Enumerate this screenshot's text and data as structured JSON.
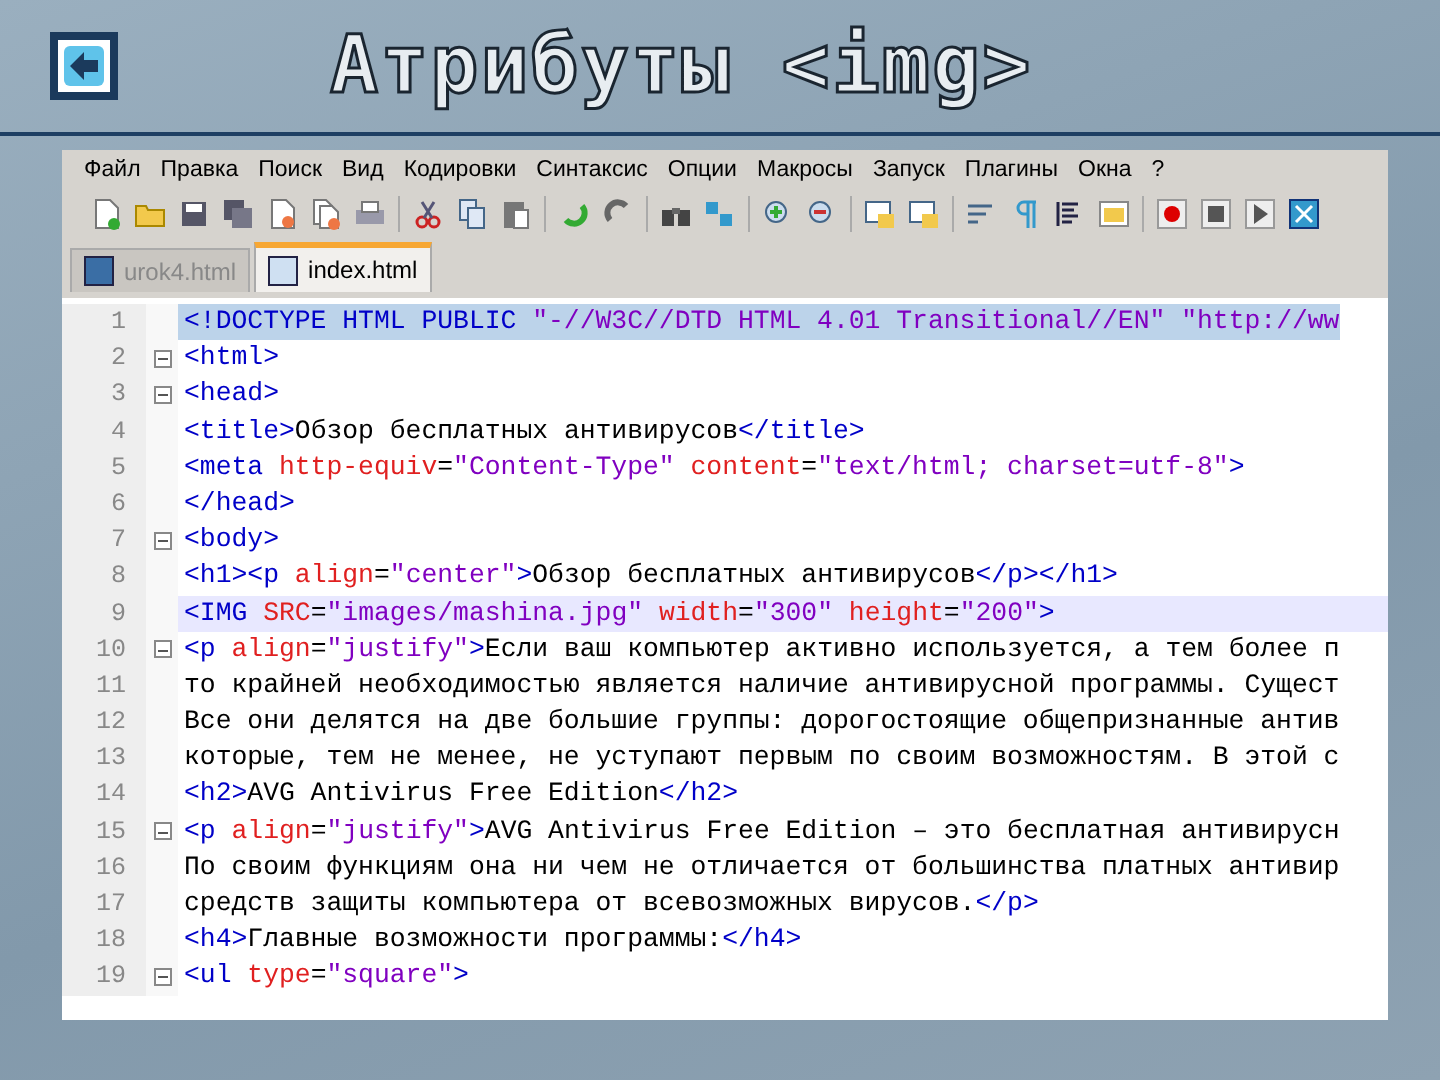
{
  "slide": {
    "title": "Атрибуты <img>"
  },
  "menu": [
    "Файл",
    "Правка",
    "Поиск",
    "Вид",
    "Кодировки",
    "Синтаксис",
    "Опции",
    "Макросы",
    "Запуск",
    "Плагины",
    "Окна",
    "?"
  ],
  "tabs": [
    {
      "label": "urok4.html",
      "selected": false
    },
    {
      "label": "index.html",
      "selected": true
    }
  ],
  "lines": [
    {
      "number": "1",
      "fold": false,
      "current": false,
      "marked": true,
      "segments": [
        {
          "kind": "tag",
          "text": "<!DOCTYPE HTML PUBLIC "
        },
        {
          "kind": "value",
          "text": "\"-//W3C//DTD HTML 4.01 Transitional//EN\""
        },
        {
          "kind": "value",
          "text": " \"http://ww"
        }
      ]
    },
    {
      "number": "2",
      "fold": true,
      "current": false,
      "marked": false,
      "segments": [
        {
          "kind": "tag",
          "text": "<html>"
        }
      ]
    },
    {
      "number": "3",
      "fold": true,
      "current": false,
      "marked": false,
      "segments": [
        {
          "kind": "tag",
          "text": "<head>"
        }
      ]
    },
    {
      "number": "4",
      "fold": false,
      "current": false,
      "marked": false,
      "segments": [
        {
          "kind": "tag",
          "text": "<title>"
        },
        {
          "kind": "text",
          "text": "Обзор бесплатных антивирусов"
        },
        {
          "kind": "tag",
          "text": "</title>"
        }
      ]
    },
    {
      "number": "5",
      "fold": false,
      "current": false,
      "marked": false,
      "segments": [
        {
          "kind": "tag",
          "text": "<meta "
        },
        {
          "kind": "attr",
          "text": "http-equiv"
        },
        {
          "kind": "text",
          "text": "="
        },
        {
          "kind": "value",
          "text": "\"Content-Type\""
        },
        {
          "kind": "attr",
          "text": " content"
        },
        {
          "kind": "text",
          "text": "="
        },
        {
          "kind": "value",
          "text": "\"text/html; charset=utf-8\""
        },
        {
          "kind": "tag",
          "text": ">"
        }
      ]
    },
    {
      "number": "6",
      "fold": false,
      "current": false,
      "marked": false,
      "segments": [
        {
          "kind": "tag",
          "text": "</head>"
        }
      ]
    },
    {
      "number": "7",
      "fold": true,
      "current": false,
      "marked": false,
      "segments": [
        {
          "kind": "tag",
          "text": "<body>"
        }
      ]
    },
    {
      "number": "8",
      "fold": false,
      "current": false,
      "marked": false,
      "segments": [
        {
          "kind": "tag",
          "text": "<h1><p "
        },
        {
          "kind": "attr",
          "text": "align"
        },
        {
          "kind": "text",
          "text": "="
        },
        {
          "kind": "value",
          "text": "\"center\""
        },
        {
          "kind": "tag",
          "text": ">"
        },
        {
          "kind": "text",
          "text": "Обзор бесплатных антивирусов"
        },
        {
          "kind": "tag",
          "text": "</p></h1>"
        }
      ]
    },
    {
      "number": "9",
      "fold": false,
      "current": true,
      "marked": false,
      "segments": [
        {
          "kind": "tag",
          "text": "<IMG "
        },
        {
          "kind": "attr",
          "text": "SRC"
        },
        {
          "kind": "text",
          "text": "="
        },
        {
          "kind": "value",
          "text": "\"images/mashina.jpg\""
        },
        {
          "kind": "attr",
          "text": " width"
        },
        {
          "kind": "text",
          "text": "="
        },
        {
          "kind": "value",
          "text": "\"300\""
        },
        {
          "kind": "attr",
          "text": " height"
        },
        {
          "kind": "text",
          "text": "="
        },
        {
          "kind": "value",
          "text": "\"200\""
        },
        {
          "kind": "tag",
          "text": ">"
        }
      ]
    },
    {
      "number": "10",
      "fold": true,
      "current": false,
      "marked": false,
      "segments": [
        {
          "kind": "tag",
          "text": "<p "
        },
        {
          "kind": "attr",
          "text": "align"
        },
        {
          "kind": "text",
          "text": "="
        },
        {
          "kind": "value",
          "text": "\"justify\""
        },
        {
          "kind": "tag",
          "text": ">"
        },
        {
          "kind": "text",
          "text": "Если ваш компьютер активно используется, а тем более п"
        }
      ]
    },
    {
      "number": "11",
      "fold": false,
      "current": false,
      "marked": false,
      "segments": [
        {
          "kind": "text",
          "text": "то крайней необходимостью является наличие антивирусной программы. Сущест"
        }
      ]
    },
    {
      "number": "12",
      "fold": false,
      "current": false,
      "marked": false,
      "segments": [
        {
          "kind": "text",
          "text": "Все они делятся на две большие группы: дорогостоящие общепризнанные антив"
        }
      ]
    },
    {
      "number": "13",
      "fold": false,
      "current": false,
      "marked": false,
      "segments": [
        {
          "kind": "text",
          "text": "которые, тем не менее, не уступают первым по своим возможностям. В этой с"
        }
      ]
    },
    {
      "number": "14",
      "fold": false,
      "current": false,
      "marked": false,
      "segments": [
        {
          "kind": "tag",
          "text": "<h2>"
        },
        {
          "kind": "text",
          "text": "AVG Antivirus Free Edition"
        },
        {
          "kind": "tag",
          "text": "</h2>"
        }
      ]
    },
    {
      "number": "15",
      "fold": true,
      "current": false,
      "marked": false,
      "segments": [
        {
          "kind": "tag",
          "text": "<p "
        },
        {
          "kind": "attr",
          "text": "align"
        },
        {
          "kind": "text",
          "text": "="
        },
        {
          "kind": "value",
          "text": "\"justify\""
        },
        {
          "kind": "tag",
          "text": ">"
        },
        {
          "kind": "text",
          "text": "AVG Antivirus Free Edition – это бесплатная антивирусн"
        }
      ]
    },
    {
      "number": "16",
      "fold": false,
      "current": false,
      "marked": false,
      "segments": [
        {
          "kind": "text",
          "text": "По своим функциям она ни чем не отличается от большинства платных антивир"
        }
      ]
    },
    {
      "number": "17",
      "fold": false,
      "current": false,
      "marked": false,
      "segments": [
        {
          "kind": "text",
          "text": "средств защиты компьютера от всевозможных вирусов."
        },
        {
          "kind": "tag",
          "text": "</p>"
        }
      ]
    },
    {
      "number": "18",
      "fold": false,
      "current": false,
      "marked": false,
      "segments": [
        {
          "kind": "tag",
          "text": "<h4>"
        },
        {
          "kind": "text",
          "text": "Главные возможности программы:"
        },
        {
          "kind": "tag",
          "text": "</h4>"
        }
      ]
    },
    {
      "number": "19",
      "fold": true,
      "current": false,
      "marked": false,
      "segments": [
        {
          "kind": "tag",
          "text": "<ul "
        },
        {
          "kind": "attr",
          "text": "type"
        },
        {
          "kind": "text",
          "text": "="
        },
        {
          "kind": "value",
          "text": "\"square\""
        },
        {
          "kind": "tag",
          "text": ">"
        }
      ]
    }
  ]
}
